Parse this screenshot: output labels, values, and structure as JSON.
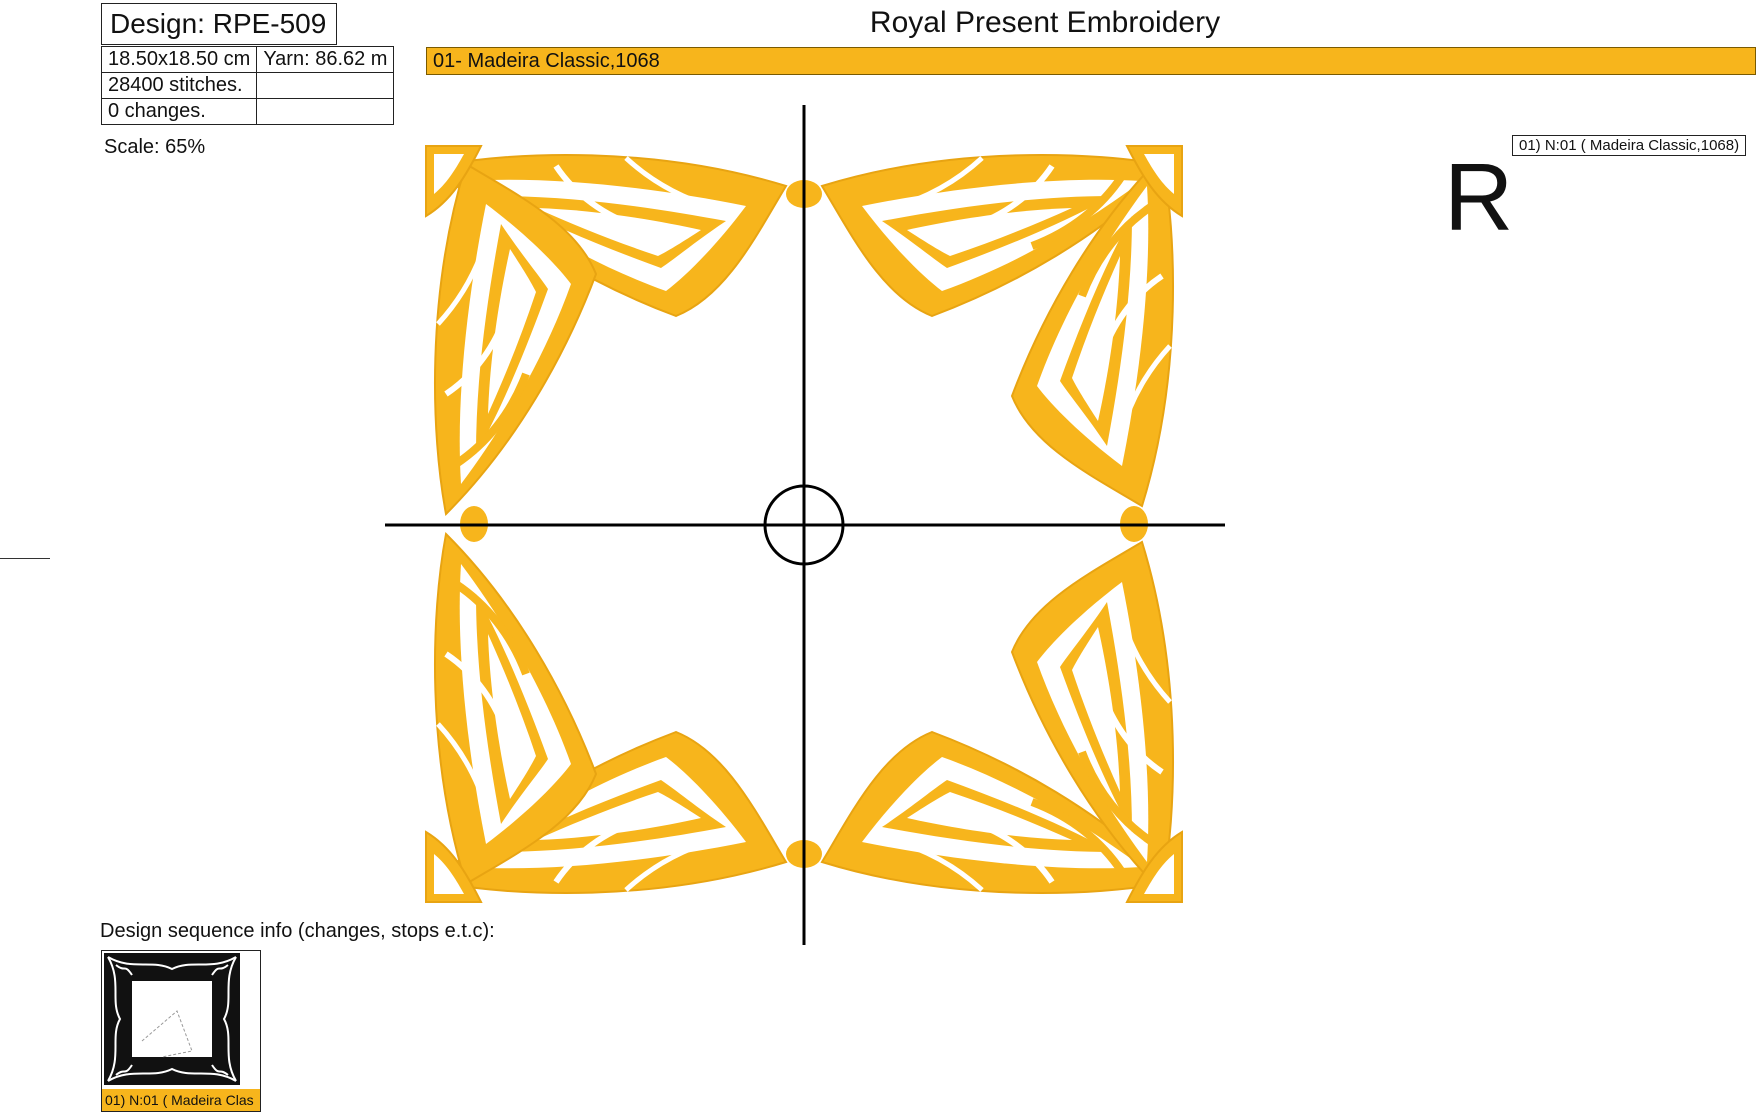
{
  "header": {
    "design_title": "Design: RPE-509",
    "brand": "Royal Present Embroidery"
  },
  "info": {
    "size": "18.50x18.50 cm",
    "yarn": "Yarn: 86.62 m",
    "stitches": "28400 stitches.",
    "changes": "0 changes."
  },
  "thread_bar": {
    "label": "01- Madeira Classic,1068",
    "color": "#f7b51c"
  },
  "scale": "Scale: 65%",
  "legend": "01) N:01 ( Madeira Classic,1068)",
  "orientation_mark": "R",
  "sequence": {
    "label": "Design sequence info (changes, stops e.t.c):",
    "thumb_caption": "01) N:01 ( Madeira Clas"
  },
  "colors": {
    "thread": "#f7b51c",
    "thread_dark": "#e8a412"
  }
}
